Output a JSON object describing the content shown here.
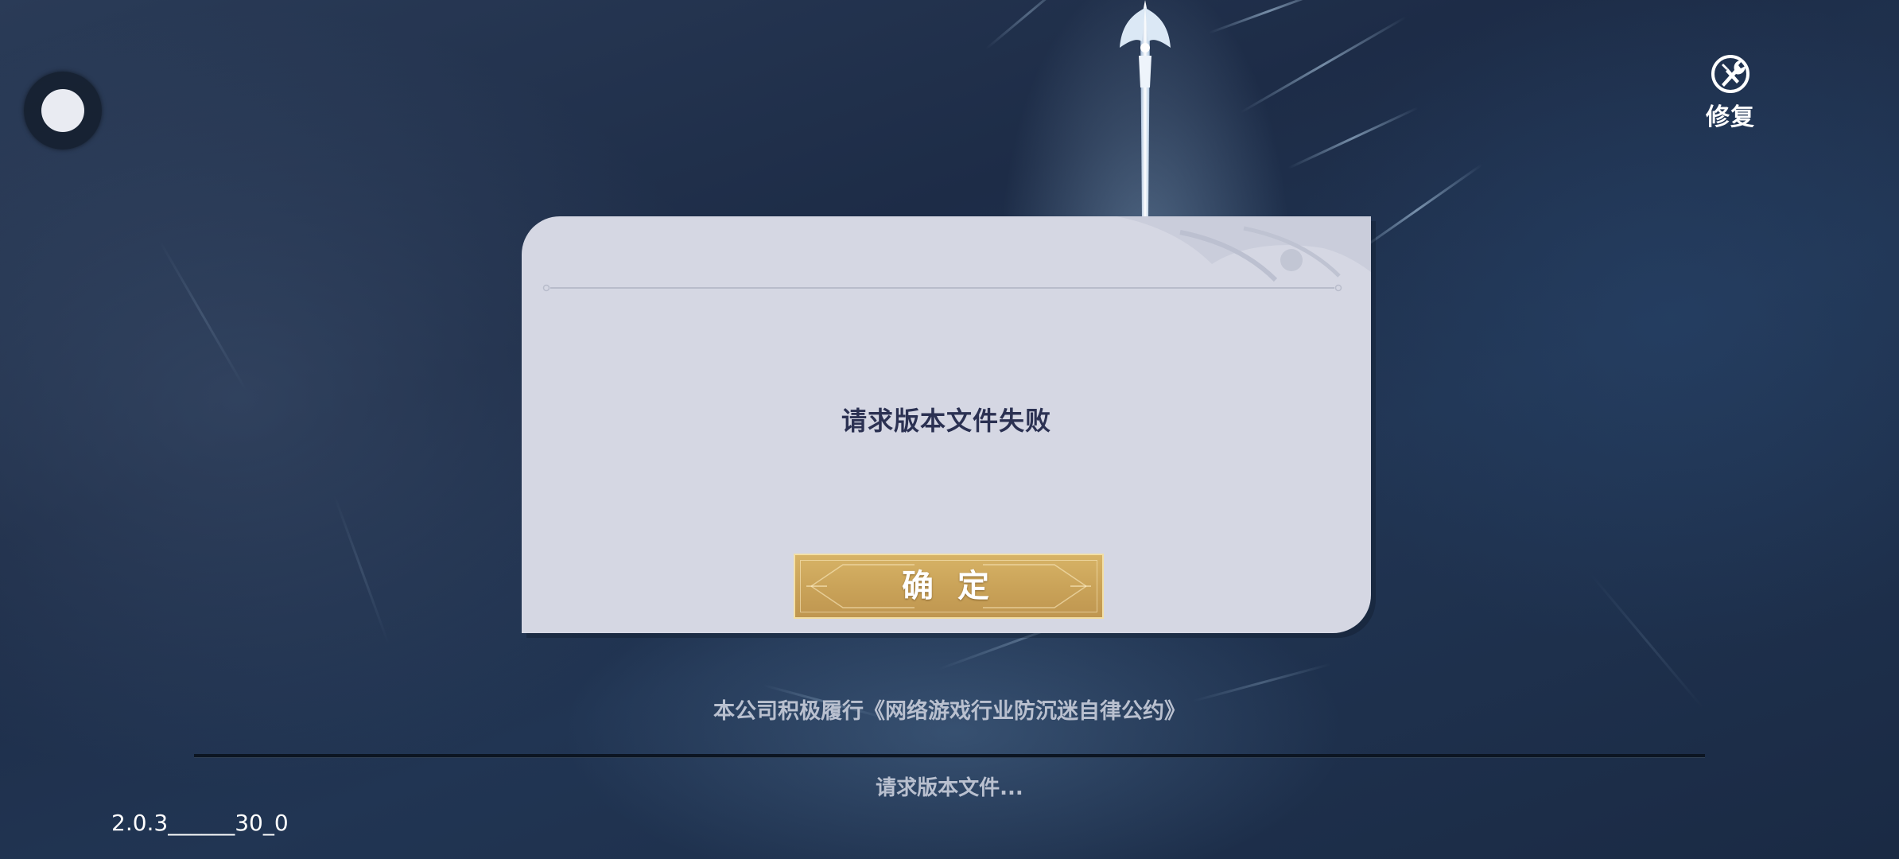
{
  "top_left": {
    "icon": "floating-ball-icon"
  },
  "repair": {
    "icon": "wrench-screwdriver-icon",
    "label": "修复"
  },
  "dialog": {
    "message": "请求版本文件失败",
    "confirm_label": "确 定"
  },
  "footer": {
    "notice": "本公司积极履行《网络游戏行业防沉迷自律公约》",
    "progress": 0,
    "status": "请求版本文件...",
    "version": "2.0.3______30_0"
  },
  "colors": {
    "dialog_bg": "#d5d7e3",
    "button_gold": "#c9a258",
    "text_dark": "#2b3152",
    "text_light": "#b9c0cf"
  }
}
